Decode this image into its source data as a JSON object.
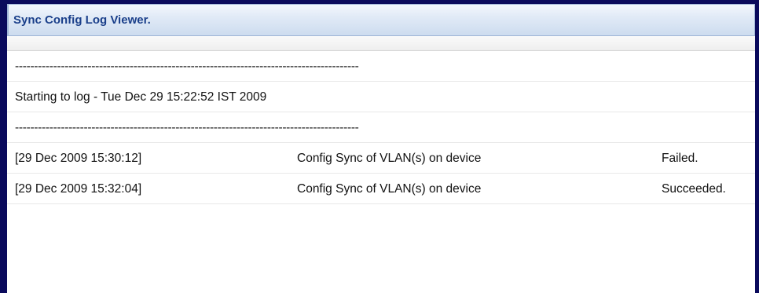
{
  "window": {
    "title": "Sync Config Log Viewer."
  },
  "log": {
    "header_lines": [
      {
        "text": "------------------------------------------------------------------------------------------"
      },
      {
        "text": "Starting to log - Tue Dec 29 15:22:52 IST 2009"
      },
      {
        "text": "------------------------------------------------------------------------------------------"
      }
    ],
    "entries": [
      {
        "timestamp": "[29 Dec 2009 15:30:12]",
        "message": "Config Sync of VLAN(s) on device",
        "status": "Failed."
      },
      {
        "timestamp": "[29 Dec 2009 15:32:04]",
        "message": "Config Sync of VLAN(s) on device",
        "status": "Succeeded."
      }
    ]
  },
  "colors": {
    "window_border": "#0a0a5c",
    "title_text": "#1a3f8a",
    "title_bar_gradient_top": "#f2f6fc",
    "title_bar_gradient_bottom": "#cddcef"
  }
}
